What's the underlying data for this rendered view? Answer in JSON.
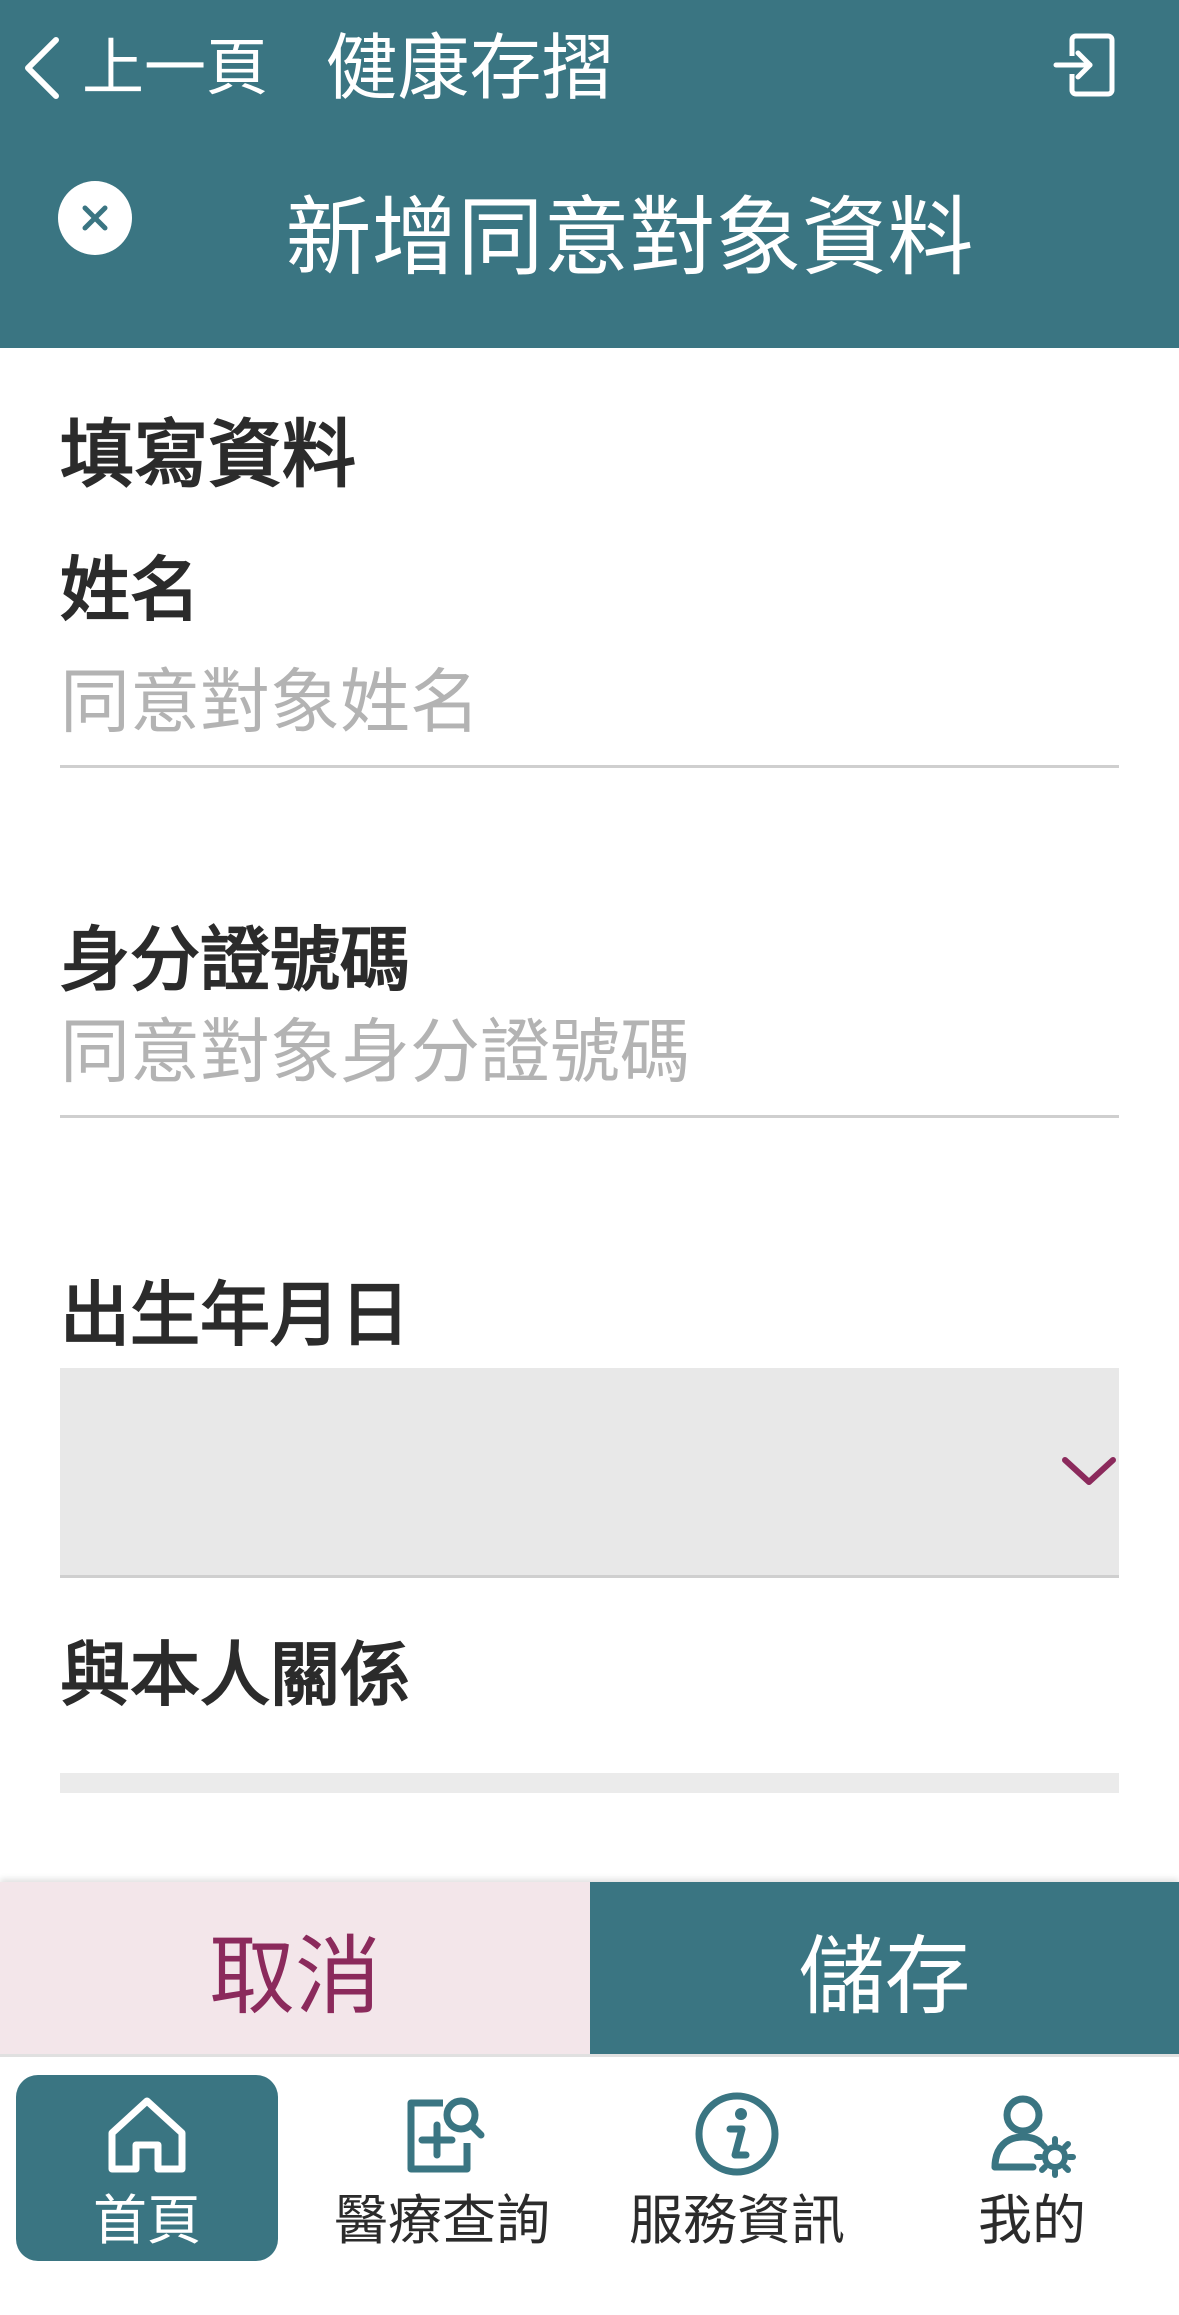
{
  "topbar": {
    "back_label": "上一頁",
    "app_title": "健康存摺",
    "back_icon": "chevron-left-icon",
    "logout_icon": "logout-icon"
  },
  "modal": {
    "title": "新增同意對象資料",
    "close_icon": "close-icon"
  },
  "form": {
    "section_title": "填寫資料",
    "name": {
      "label": "姓名",
      "placeholder": "同意對象姓名",
      "value": ""
    },
    "id_number": {
      "label": "身分證號碼",
      "placeholder": "同意對象身分證號碼",
      "value": ""
    },
    "birthdate": {
      "label": "出生年月日",
      "value": ""
    },
    "relationship": {
      "label": "與本人關係",
      "value": ""
    }
  },
  "actions": {
    "cancel_label": "取消",
    "save_label": "儲存"
  },
  "bottom_nav": [
    {
      "label": "首頁",
      "icon": "home-icon",
      "active": true
    },
    {
      "label": "醫療查詢",
      "icon": "medical-search-icon",
      "active": false
    },
    {
      "label": "服務資訊",
      "icon": "info-icon",
      "active": false
    },
    {
      "label": "我的",
      "icon": "user-settings-icon",
      "active": false
    }
  ],
  "colors": {
    "primary": "#3a7582",
    "accent": "#8b2a5c",
    "cancel_bg": "#f3e6ea"
  }
}
